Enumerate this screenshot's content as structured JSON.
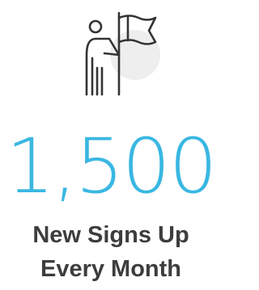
{
  "icon": "person-with-flag-icon",
  "colors": {
    "accent": "#39b7e2",
    "text": "#3d3d3d",
    "icon_stroke": "#333333",
    "icon_circle": "#eeeeee"
  },
  "stat": {
    "value": "1,500",
    "caption_line1": "New Signs Up",
    "caption_line2": "Every Month"
  }
}
